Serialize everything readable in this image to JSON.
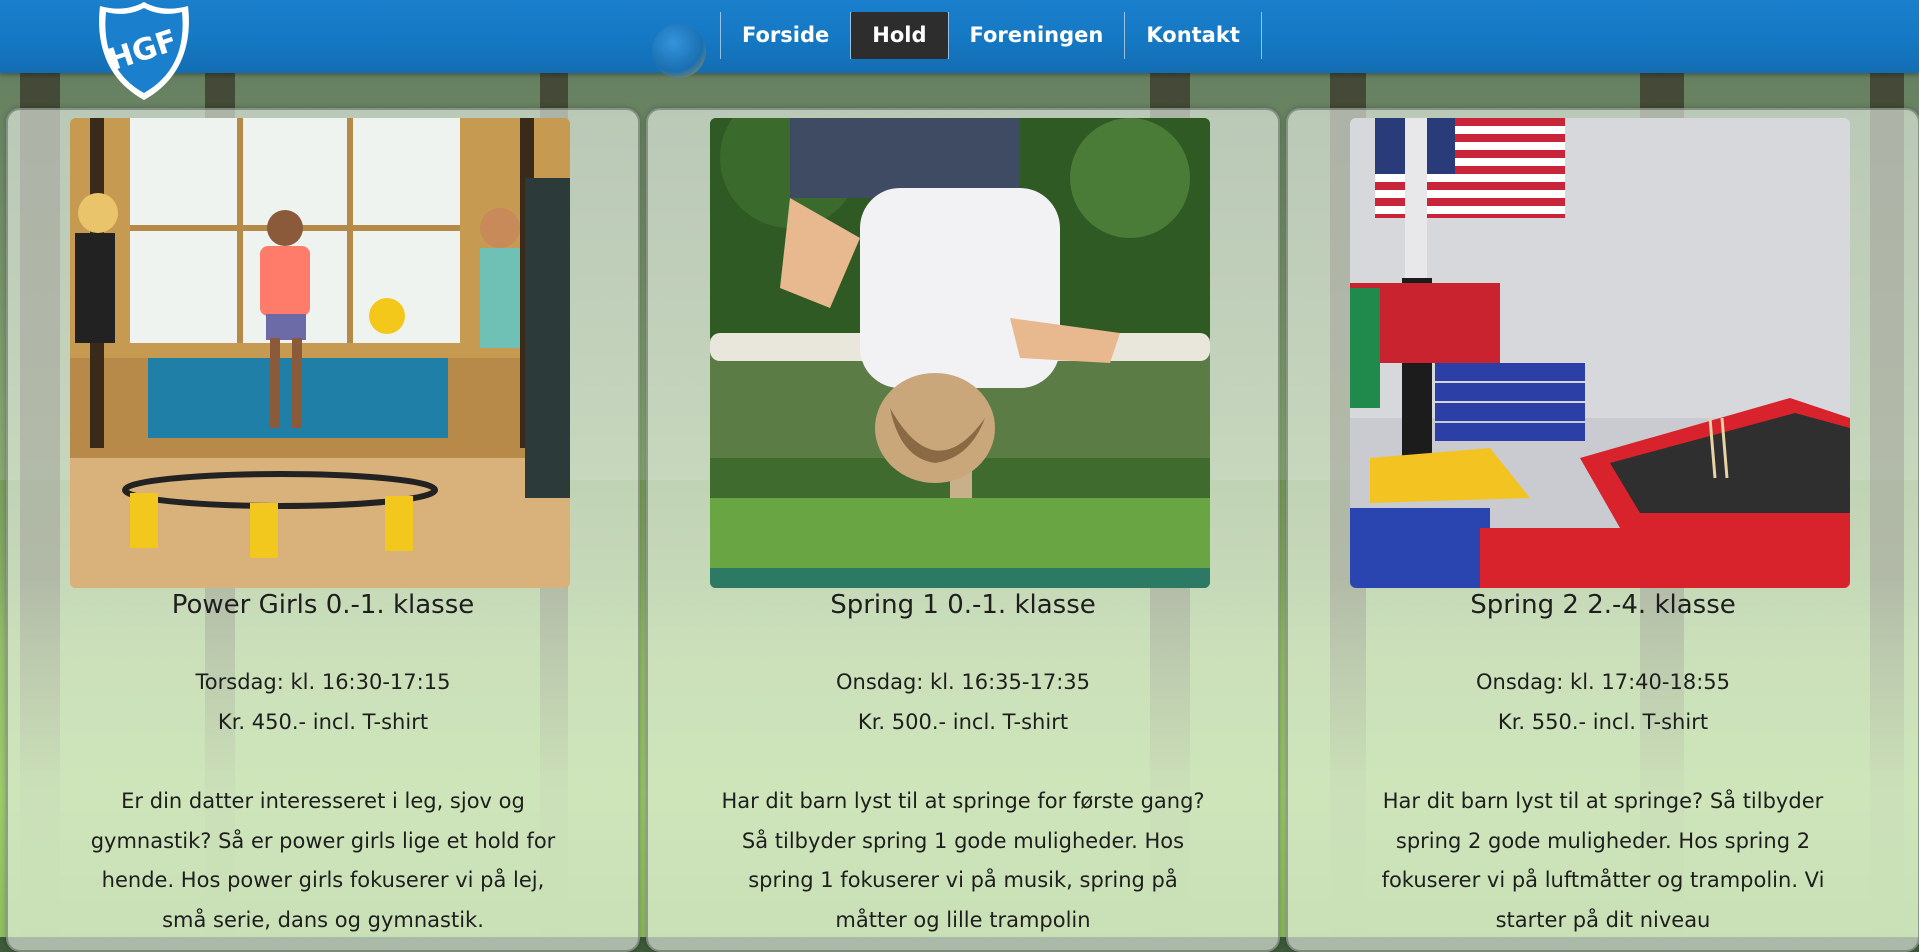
{
  "site": {
    "logo_text": "HGF"
  },
  "nav": {
    "items": [
      {
        "label": "Forside",
        "active": false
      },
      {
        "label": "Hold",
        "active": true
      },
      {
        "label": "Foreningen",
        "active": false
      },
      {
        "label": "Kontakt",
        "active": false
      }
    ]
  },
  "cards": [
    {
      "title": "Power Girls 0.-1. klasse",
      "schedule": "Torsdag: kl. 16:30-17:15",
      "price": "Kr. 450.- incl. T-shirt",
      "description": "Er din datter interesseret i leg, sjov og gymnastik? Så er power girls lige et hold for hende. Hos power girls fokuserer vi på lej, små serie, dans og gymnastik."
    },
    {
      "title": "Spring 1 0.-1. klasse",
      "schedule": "Onsdag: kl. 16:35-17:35",
      "price": "Kr. 500.- incl. T-shirt",
      "description": "Har dit barn lyst til at springe for første gang? Så tilbyder spring 1 gode muligheder. Hos spring 1 fokuserer vi på musik, spring på måtter og lille trampolin"
    },
    {
      "title": "Spring 2 2.-4. klasse",
      "schedule": "Onsdag: kl. 17:40-18:55",
      "price": "Kr. 550.- incl. T-shirt",
      "description": "Har dit barn lyst til at springe? Så tilbyder spring 2 gode muligheder. Hos spring 2 fokuserer vi på luftmåtter og trampolin. Vi starter på dit niveau"
    }
  ],
  "colors": {
    "header_blue": "#1578c3",
    "nav_active_bg": "#2d2d2d",
    "text": "#1e1e1e"
  }
}
